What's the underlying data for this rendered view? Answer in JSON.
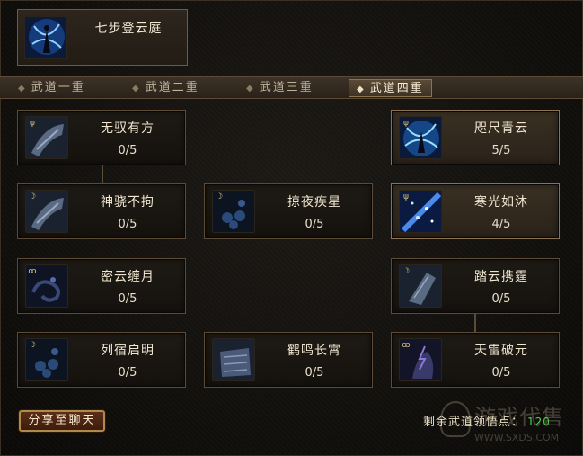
{
  "header_skill": {
    "name": "七步登云庭",
    "icon": "ascending-figure-icon"
  },
  "tabs": [
    {
      "label": "武道一重",
      "active": false
    },
    {
      "label": "武道二重",
      "active": false
    },
    {
      "label": "武道三重",
      "active": false
    },
    {
      "label": "武道四重",
      "active": true
    }
  ],
  "skills": [
    {
      "name": "无驭有方",
      "level": "0/5",
      "active": false,
      "icon": "leaping-figure-icon"
    },
    {
      "name": "神骁不拘",
      "level": "0/5",
      "active": false,
      "icon": "leaping-figure-icon"
    },
    {
      "name": "密云缠月",
      "level": "0/5",
      "active": false,
      "icon": "swirl-cloud-icon"
    },
    {
      "name": "列宿启明",
      "level": "0/5",
      "active": false,
      "icon": "star-orbs-icon"
    },
    {
      "name": "掠夜疾星",
      "level": "0/5",
      "active": false,
      "icon": "star-orbs-icon"
    },
    {
      "name": "鹤鸣长霄",
      "level": "0/5",
      "active": false,
      "icon": "scroll-wings-icon"
    },
    {
      "name": "咫尺青云",
      "level": "5/5",
      "active": true,
      "icon": "ascending-figure-icon"
    },
    {
      "name": "寒光如沐",
      "level": "4/5",
      "active": true,
      "icon": "ice-sparkle-icon"
    },
    {
      "name": "踏云携霆",
      "level": "0/5",
      "active": false,
      "icon": "cloud-step-icon"
    },
    {
      "name": "天雷破元",
      "level": "0/5",
      "active": false,
      "icon": "thunder-figure-icon"
    }
  ],
  "share_button": "分享至聊天",
  "points": {
    "label": "剩余武道领悟点：",
    "value": "120"
  },
  "watermark": {
    "text": "游戏代售",
    "url": "WWW.SXDS.COM"
  },
  "colors": {
    "active_border": "#8a7352",
    "points_value": "#4ad04a",
    "button_border": "#b08a4a"
  }
}
